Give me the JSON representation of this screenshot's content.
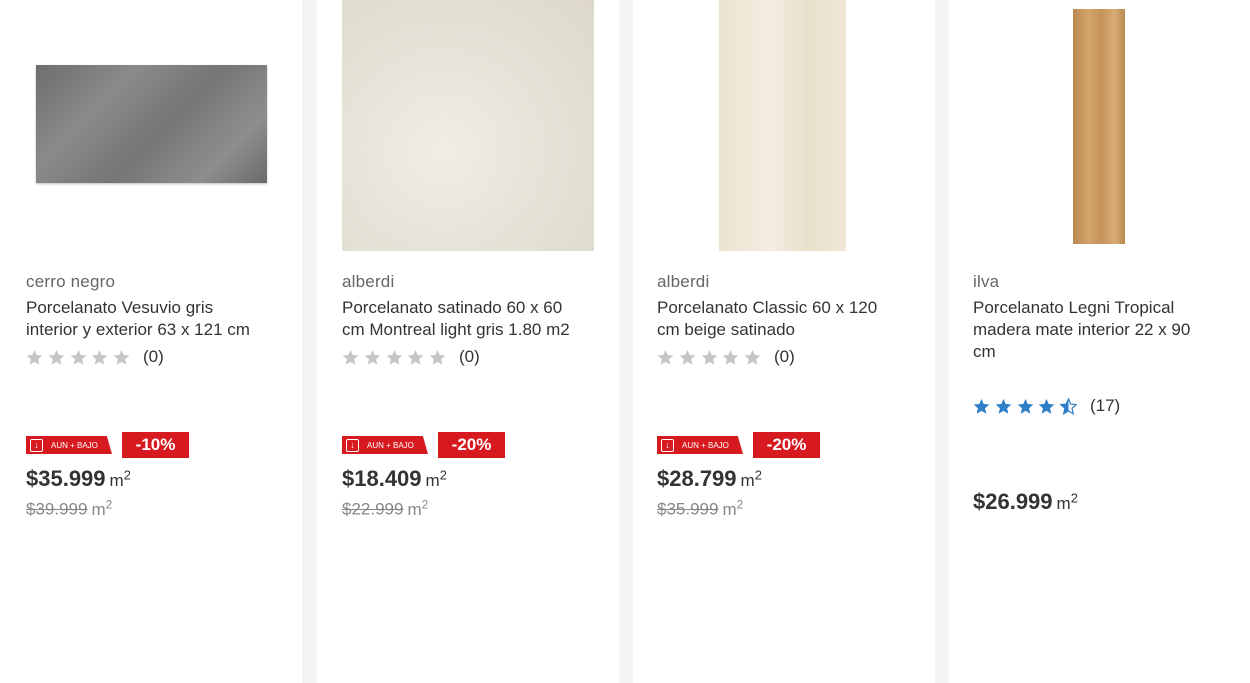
{
  "products": [
    {
      "brand": "cerro negro",
      "title_line1": "Porcelanato Vesuvio gris",
      "title_line2": "interior y exterior 63 x 121 cm",
      "title_line3": "",
      "rating_value": 0,
      "rating_count": "(0)",
      "badge_low": "AUN + BAJO",
      "discount": "-10%",
      "price": "$35.999",
      "unit": "m",
      "unit_sup": "2",
      "old_price": "$39.999",
      "tile_color": "#7b7b7b"
    },
    {
      "brand": "alberdi",
      "title_line1": "Porcelanato satinado 60 x 60",
      "title_line2": "cm Montreal light gris 1.80 m2",
      "title_line3": "",
      "rating_value": 0,
      "rating_count": "(0)",
      "badge_low": "AUN + BAJO",
      "discount": "-20%",
      "price": "$18.409",
      "unit": "m",
      "unit_sup": "2",
      "old_price": "$22.999",
      "tile_color": "#e9e6dc"
    },
    {
      "brand": "alberdi",
      "title_line1": "Porcelanato Classic 60 x 120",
      "title_line2": "cm beige satinado",
      "title_line3": "",
      "rating_value": 0,
      "rating_count": "(0)",
      "badge_low": "AUN + BAJO",
      "discount": "-20%",
      "price": "$28.799",
      "unit": "m",
      "unit_sup": "2",
      "old_price": "$35.999",
      "tile_color": "#efe8d8"
    },
    {
      "brand": "ilva",
      "title_line1": "Porcelanato Legni Tropical",
      "title_line2": "madera mate interior 22 x 90",
      "title_line3": "cm",
      "rating_value": 4.5,
      "rating_count": "(17)",
      "badge_low": "",
      "discount": "",
      "price": "$26.999",
      "unit": "m",
      "unit_sup": "2",
      "old_price": "",
      "tile_color": "#c79a62"
    }
  ],
  "colors": {
    "accent_red": "#d71a20",
    "star_empty": "#c6c6c6",
    "star_filled": "#2f7ec8"
  }
}
